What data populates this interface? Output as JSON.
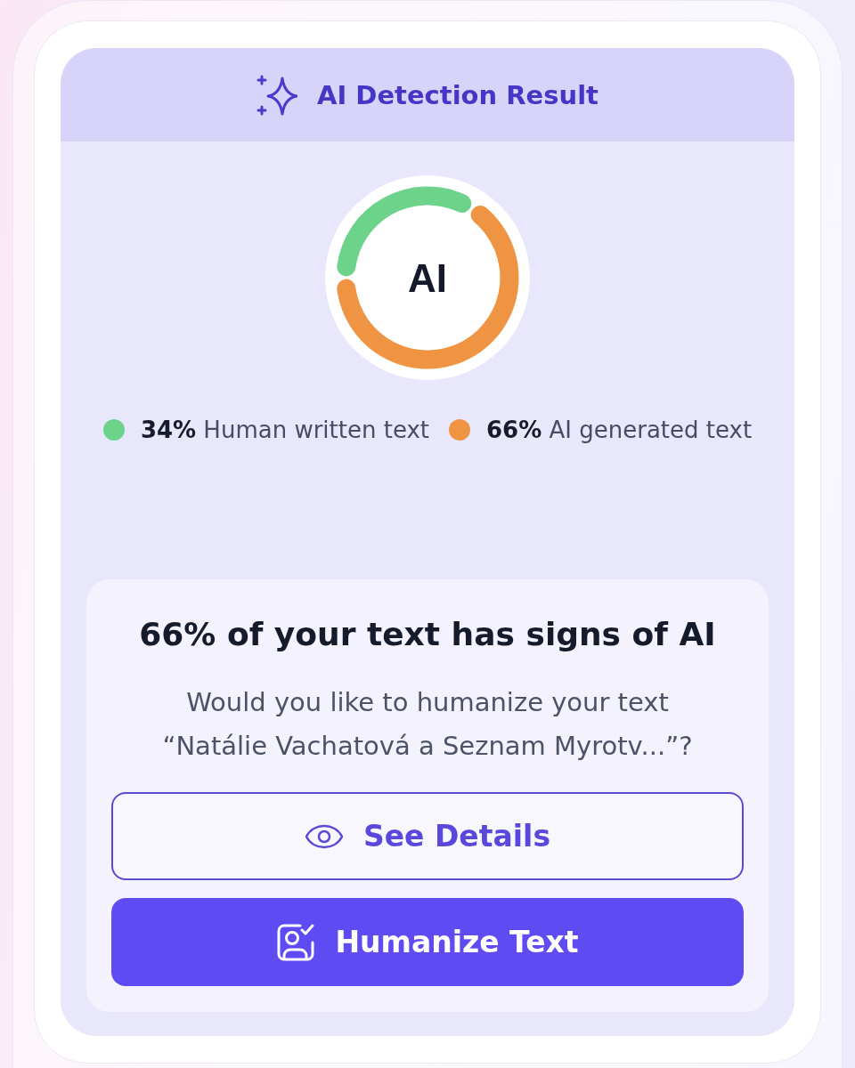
{
  "header": {
    "title": "AI Detection Result"
  },
  "result": {
    "center_label": "AI",
    "chart_data": {
      "type": "donut",
      "categories": [
        "Human written text",
        "AI generated text"
      ],
      "values": [
        34,
        66
      ]
    },
    "legend": [
      {
        "percent": "34%",
        "color": "#6dd38b"
      },
      {
        "percent": "66%",
        "color": "#ef9442"
      }
    ]
  },
  "message": {
    "heading": "66% of your text has signs of AI",
    "body": "Would you like to humanize your text “Natálie Vachatová a Seznam Myrotv...”?"
  },
  "buttons": [
    {
      "kind": "outline",
      "label": "See Details"
    },
    {
      "kind": "primary",
      "label": "Humanize Text"
    }
  ]
}
